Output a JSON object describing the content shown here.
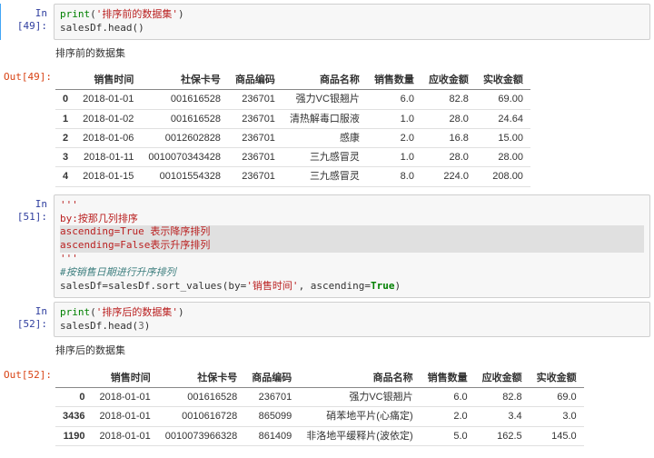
{
  "cells": [
    {
      "in_prompt": "In [49]:",
      "code_tokens": [
        [
          {
            "t": "print",
            "c": "fn"
          },
          {
            "t": "("
          },
          {
            "t": "'排序前的数据集'",
            "c": "str"
          },
          {
            "t": ")"
          }
        ],
        [
          {
            "t": "salesDf.head()"
          }
        ]
      ],
      "out_prompt": "Out[49]:",
      "stdout": "排序前的数据集",
      "table": {
        "headers": [
          "销售时间",
          "社保卡号",
          "商品编码",
          "商品名称",
          "销售数量",
          "应收金额",
          "实收金额"
        ],
        "rows": [
          {
            "idx": "0",
            "cells": [
              "2018-01-01",
              "001616528",
              "236701",
              "强力VC银翘片",
              "6.0",
              "82.8",
              "69.00"
            ]
          },
          {
            "idx": "1",
            "cells": [
              "2018-01-02",
              "001616528",
              "236701",
              "清热解毒口服液",
              "1.0",
              "28.0",
              "24.64"
            ]
          },
          {
            "idx": "2",
            "cells": [
              "2018-01-06",
              "0012602828",
              "236701",
              "感康",
              "2.0",
              "16.8",
              "15.00"
            ]
          },
          {
            "idx": "3",
            "cells": [
              "2018-01-11",
              "0010070343428",
              "236701",
              "三九感冒灵",
              "1.0",
              "28.0",
              "28.00"
            ]
          },
          {
            "idx": "4",
            "cells": [
              "2018-01-15",
              "00101554328",
              "236701",
              "三九感冒灵",
              "8.0",
              "224.0",
              "208.00"
            ]
          }
        ]
      }
    },
    {
      "in_prompt": "In [51]:",
      "code_tokens": [
        [
          {
            "t": "'''",
            "c": "docstr"
          }
        ],
        [
          {
            "t": "by:按那几列排序",
            "c": "docstr"
          }
        ],
        [
          {
            "t": "ascending=True 表示降序排列",
            "c": "docstr",
            "hl": true
          }
        ],
        [
          {
            "t": "ascending=False表示升序排列",
            "c": "docstr",
            "hl": true
          }
        ],
        [
          {
            "t": "'''",
            "c": "docstr"
          }
        ],
        [
          {
            "t": "#按销售日期进行升序排列",
            "c": "com"
          }
        ],
        [
          {
            "t": "salesDf=salesDf.sort_values(by="
          },
          {
            "t": "'销售时间'",
            "c": "str"
          },
          {
            "t": ", ascending="
          },
          {
            "t": "True",
            "c": "kw"
          },
          {
            "t": ")"
          }
        ]
      ]
    },
    {
      "in_prompt": "In [52]:",
      "code_tokens": [
        [
          {
            "t": "print",
            "c": "fn"
          },
          {
            "t": "("
          },
          {
            "t": "'排序后的数据集'",
            "c": "str"
          },
          {
            "t": ")"
          }
        ],
        [
          {
            "t": "salesDf.head("
          },
          {
            "t": "3",
            "c": "num"
          },
          {
            "t": ")"
          }
        ]
      ],
      "out_prompt": "Out[52]:",
      "stdout": "排序后的数据集",
      "table": {
        "headers": [
          "销售时间",
          "社保卡号",
          "商品编码",
          "商品名称",
          "销售数量",
          "应收金额",
          "实收金额"
        ],
        "rows": [
          {
            "idx": "0",
            "cells": [
              "2018-01-01",
              "001616528",
              "236701",
              "强力VC银翘片",
              "6.0",
              "82.8",
              "69.0"
            ]
          },
          {
            "idx": "3436",
            "cells": [
              "2018-01-01",
              "0010616728",
              "865099",
              "硝苯地平片(心痛定)",
              "2.0",
              "3.4",
              "3.0"
            ]
          },
          {
            "idx": "1190",
            "cells": [
              "2018-01-01",
              "0010073966328",
              "861409",
              "非洛地平缓释片(波依定)",
              "5.0",
              "162.5",
              "145.0"
            ]
          }
        ]
      }
    }
  ]
}
